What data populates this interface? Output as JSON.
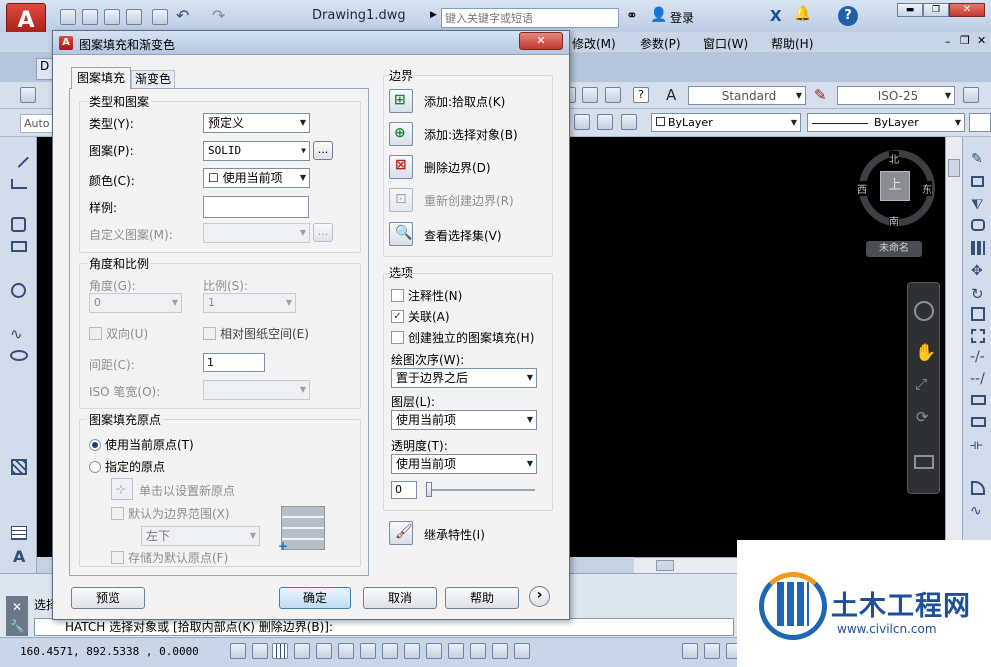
{
  "app": {
    "title": "Drawing1.dwg",
    "search_placeholder": "键入关键字或短语",
    "login_label": "登录",
    "menus": [
      "修改(M)",
      "参数(P)",
      "窗口(W)",
      "帮助(H)"
    ],
    "file_tab_initial": "D",
    "auto_label": "Auto",
    "text_style": "Standard",
    "dim_style": "ISO-25",
    "layer_color": "ByLayer",
    "linetype": "ByLayer",
    "compass": {
      "north": "北",
      "south": "南",
      "east": "东",
      "west": "西",
      "top": "上",
      "ucs": "未命名"
    },
    "command_line": {
      "history_prefix": "选择",
      "text": "HATCH 选择对象或 [拾取内部点(K) 删除边界(B)]:"
    },
    "coords": "160.4571, 892.5338 , 0.0000"
  },
  "dialog": {
    "title": "图案填充和渐变色",
    "tabs": [
      "图案填充",
      "渐变色"
    ],
    "type_pattern": {
      "group": "类型和图案",
      "type_label": "类型(Y):",
      "type_value": "预定义",
      "pattern_label": "图案(P):",
      "pattern_value": "SOLID",
      "ellipsis": "...",
      "color_label": "颜色(C):",
      "color_value": "☐ 使用当前项",
      "swatch_label": "样例:",
      "custom_label": "自定义图案(M):",
      "custom_value": ""
    },
    "angle_scale": {
      "group": "角度和比例",
      "angle_label": "角度(G):",
      "angle_value": "0",
      "scale_label": "比例(S):",
      "scale_value": "1",
      "double_label": "双向(U)",
      "relative_label": "相对图纸空间(E)",
      "spacing_label": "间距(C):",
      "spacing_value": "1",
      "iso_label": "ISO 笔宽(O):",
      "iso_value": ""
    },
    "origin": {
      "group": "图案填充原点",
      "current_label": "使用当前原点(T)",
      "specified_label": "指定的原点",
      "click_label": "单击以设置新原点",
      "default_extent_label": "默认为边界范围(X)",
      "position_value": "左下",
      "store_label": "存储为默认原点(F)"
    },
    "boundary": {
      "group": "边界",
      "add_pick": "添加:拾取点(K)",
      "add_select": "添加:选择对象(B)",
      "remove": "删除边界(D)",
      "recreate": "重新创建边界(R)",
      "view": "查看选择集(V)"
    },
    "options": {
      "group": "选项",
      "annotative": "注释性(N)",
      "associative": "关联(A)",
      "separate": "创建独立的图案填充(H)",
      "draw_order_label": "绘图次序(W):",
      "draw_order_value": "置于边界之后",
      "layer_label": "图层(L):",
      "layer_value": "使用当前项",
      "transparency_label": "透明度(T):",
      "transparency_value": "使用当前项",
      "transparency_amount": "0",
      "transparency_level": 0
    },
    "inherit_label": "继承特性(I)",
    "buttons": {
      "preview": "预览",
      "ok": "确定",
      "cancel": "取消",
      "help": "帮助",
      "more": "›"
    }
  },
  "watermark": {
    "name": "土木工程网",
    "url": "www.civilcn.com"
  },
  "colors": {
    "canvas": "#000000",
    "frame": "#c4d2e4",
    "dialog_bg": "#f3f3f3",
    "title_bar": "#b9cde6",
    "close_red": "#c9463d",
    "app_red": "#c8201f",
    "wm_blue": "#1e67b3",
    "wm_orange": "#f29a1d"
  }
}
